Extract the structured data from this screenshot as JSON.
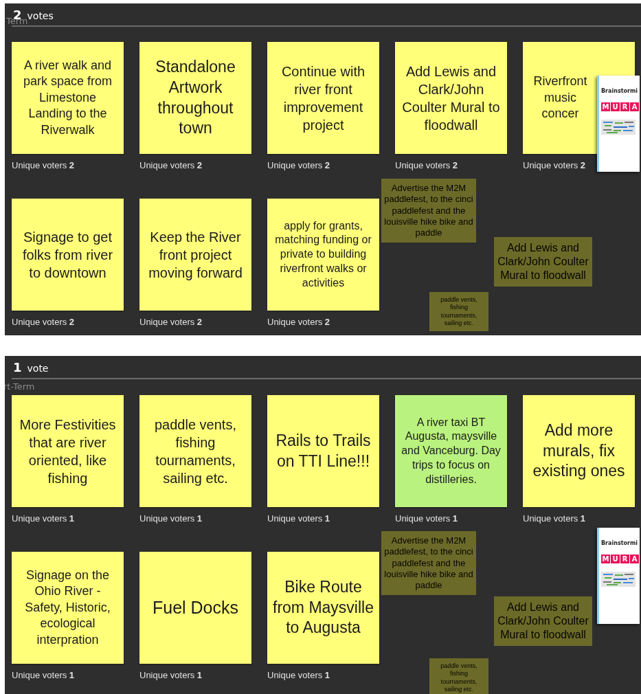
{
  "panels": [
    {
      "count": "2",
      "unit": "votes",
      "board_label": "Term",
      "cards": [
        {
          "text": "A river walk and park space from Limestone Landing to the Riverwalk",
          "color": "#ffff7a",
          "voters": "Unique voters **2**"
        },
        {
          "text": "Standalone Artwork throughout town",
          "color": "#ffff7a",
          "voters": "Unique voters **2**"
        },
        {
          "text": "Continue with river front improvement project",
          "color": "#ffff7a",
          "voters": "Unique voters **2**"
        },
        {
          "text": "Add Lewis and Clark/John Coulter Mural to floodwall",
          "color": "#ffff7a",
          "voters": "Unique voters **2**"
        },
        {
          "text": "Riverfront music concer",
          "color": "#ffff7a",
          "voters": "Unique voters **2**"
        },
        {
          "text": "Signage to get folks from river to downtown",
          "color": "#ffff7a",
          "voters": "Unique voters **2**"
        },
        {
          "text": "Keep the River front project moving forward",
          "color": "#ffff7a",
          "voters": "Unique voters **2**"
        },
        {
          "text": "apply for grants, matching funding or private to building riverfront walks or activities",
          "color": "#ffff7a",
          "voters": "Unique voters **2**"
        }
      ],
      "background_notes": [
        "Advertise the M2M paddlefest,  to the cinci paddlefest and the louisville hike bike and paddle",
        "Add Lewis and Clark/John Coulter Mural to floodwall",
        "paddle vents, fishing tournaments, sailing etc."
      ],
      "thumbnail": {
        "heading": "Brainstormi",
        "tiles": [
          "M",
          "U",
          "R",
          "A"
        ]
      }
    },
    {
      "count": "1",
      "unit": "vote",
      "board_label": "rt-Term",
      "cards": [
        {
          "text": "More Festivities that are river oriented, like fishing",
          "color": "#ffff7a",
          "voters": "Unique voters **1**"
        },
        {
          "text": "paddle vents, fishing tournaments, sailing etc.",
          "color": "#ffff7a",
          "voters": "Unique voters **1**"
        },
        {
          "text": "Rails to Trails on TTI Line!!!",
          "color": "#ffff7a",
          "voters": "Unique voters **1**"
        },
        {
          "text": "A river taxi BT Augusta, maysville and Vanceburg. Day trips to focus on distilleries.",
          "color": "#b9f27e",
          "voters": "Unique voters **1**"
        },
        {
          "text": "Add more murals, fix existing ones",
          "color": "#ffff7a",
          "voters": "Unique voters **1**"
        },
        {
          "text": "Signage on the Ohio River - Safety, Historic, ecological interpration",
          "color": "#ffff7a",
          "voters": "Unique voters **1**"
        },
        {
          "text": "Fuel Docks",
          "color": "#ffff7a",
          "voters": "Unique voters **1**"
        },
        {
          "text": "Bike Route from Maysville to Augusta",
          "color": "#ffff7a",
          "voters": "Unique voters **1**"
        }
      ],
      "background_notes": [
        "Advertise the M2M paddlefest,  to the cinci paddlefest and the louisville hike bike and paddle",
        "Add Lewis and Clark/John Coulter Mural to floodwall",
        "paddle vents, fishing tournaments, sailing etc."
      ],
      "thumbnail": {
        "heading": "Brainstormi",
        "tiles": [
          "M",
          "U",
          "R",
          "A"
        ]
      }
    }
  ]
}
